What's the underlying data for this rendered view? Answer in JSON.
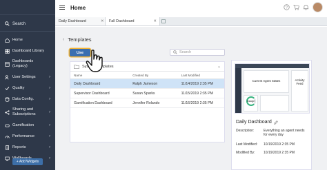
{
  "header": {
    "title": "Home"
  },
  "sidebar": {
    "search_label": "Search",
    "items": [
      {
        "label": "Home",
        "icon": "home-icon"
      },
      {
        "label": "Dashboard Library",
        "icon": "grid-icon"
      },
      {
        "label": "Dashboards (Legacy)",
        "icon": "dashboard-icon"
      },
      {
        "label": "User Settings",
        "icon": "user-gear-icon"
      },
      {
        "label": "Quality",
        "icon": "check-icon"
      },
      {
        "label": "Data Config.",
        "icon": "database-icon"
      },
      {
        "label": "Sharing and Subscriptions",
        "icon": "share-icon"
      },
      {
        "label": "Gamification",
        "icon": "gamepad-icon"
      },
      {
        "label": "Performance",
        "icon": "speedometer-icon"
      },
      {
        "label": "Reports",
        "icon": "report-icon"
      },
      {
        "label": "Wallboards",
        "icon": "monitor-icon"
      }
    ],
    "add_widgets_label": "+ Add Widgets"
  },
  "tabs": [
    {
      "label": "Daily Dashboard"
    },
    {
      "label": "Fall Dashboard"
    }
  ],
  "main": {
    "section_title": "Templates",
    "use_button_label": "Use",
    "search_placeholder": "Search",
    "folder_label": "System Templates",
    "columns": [
      "Name",
      "Created By",
      "Last Modified"
    ],
    "rows": [
      {
        "name": "Daily Dashboard",
        "created_by": "Ralph Jameson",
        "last_modified": "11/14/2019 2:35 PM",
        "selected": true
      },
      {
        "name": "Supervisor Dashboard",
        "created_by": "Susan Sparks",
        "last_modified": "11/15/2019 2:35 PM",
        "selected": false
      },
      {
        "name": "Gamification Dashboard",
        "created_by": "Jennifer Rolando",
        "last_modified": "11/16/2019 2:35 PM",
        "selected": false
      }
    ]
  },
  "preview": {
    "thumb_labels": {
      "agent_states": "Current Agent States",
      "activity_feed": "Activity Feed",
      "gauge": "Gauge"
    },
    "title": "Daily Dashboard",
    "description_label": "Description:",
    "description": "Everything an agent needs for every day",
    "last_modified_label": "Last Modified:",
    "last_modified": "10/19/2019 2:35 PM",
    "modified_by_label": "Modified By:",
    "modified_by": "10/19/2019 2:35 PM"
  },
  "colors": {
    "sidebar_bg": "#2e3849",
    "accent": "#3a6fb0",
    "highlight": "#f2b233",
    "selected_row": "#cfe3f7"
  }
}
